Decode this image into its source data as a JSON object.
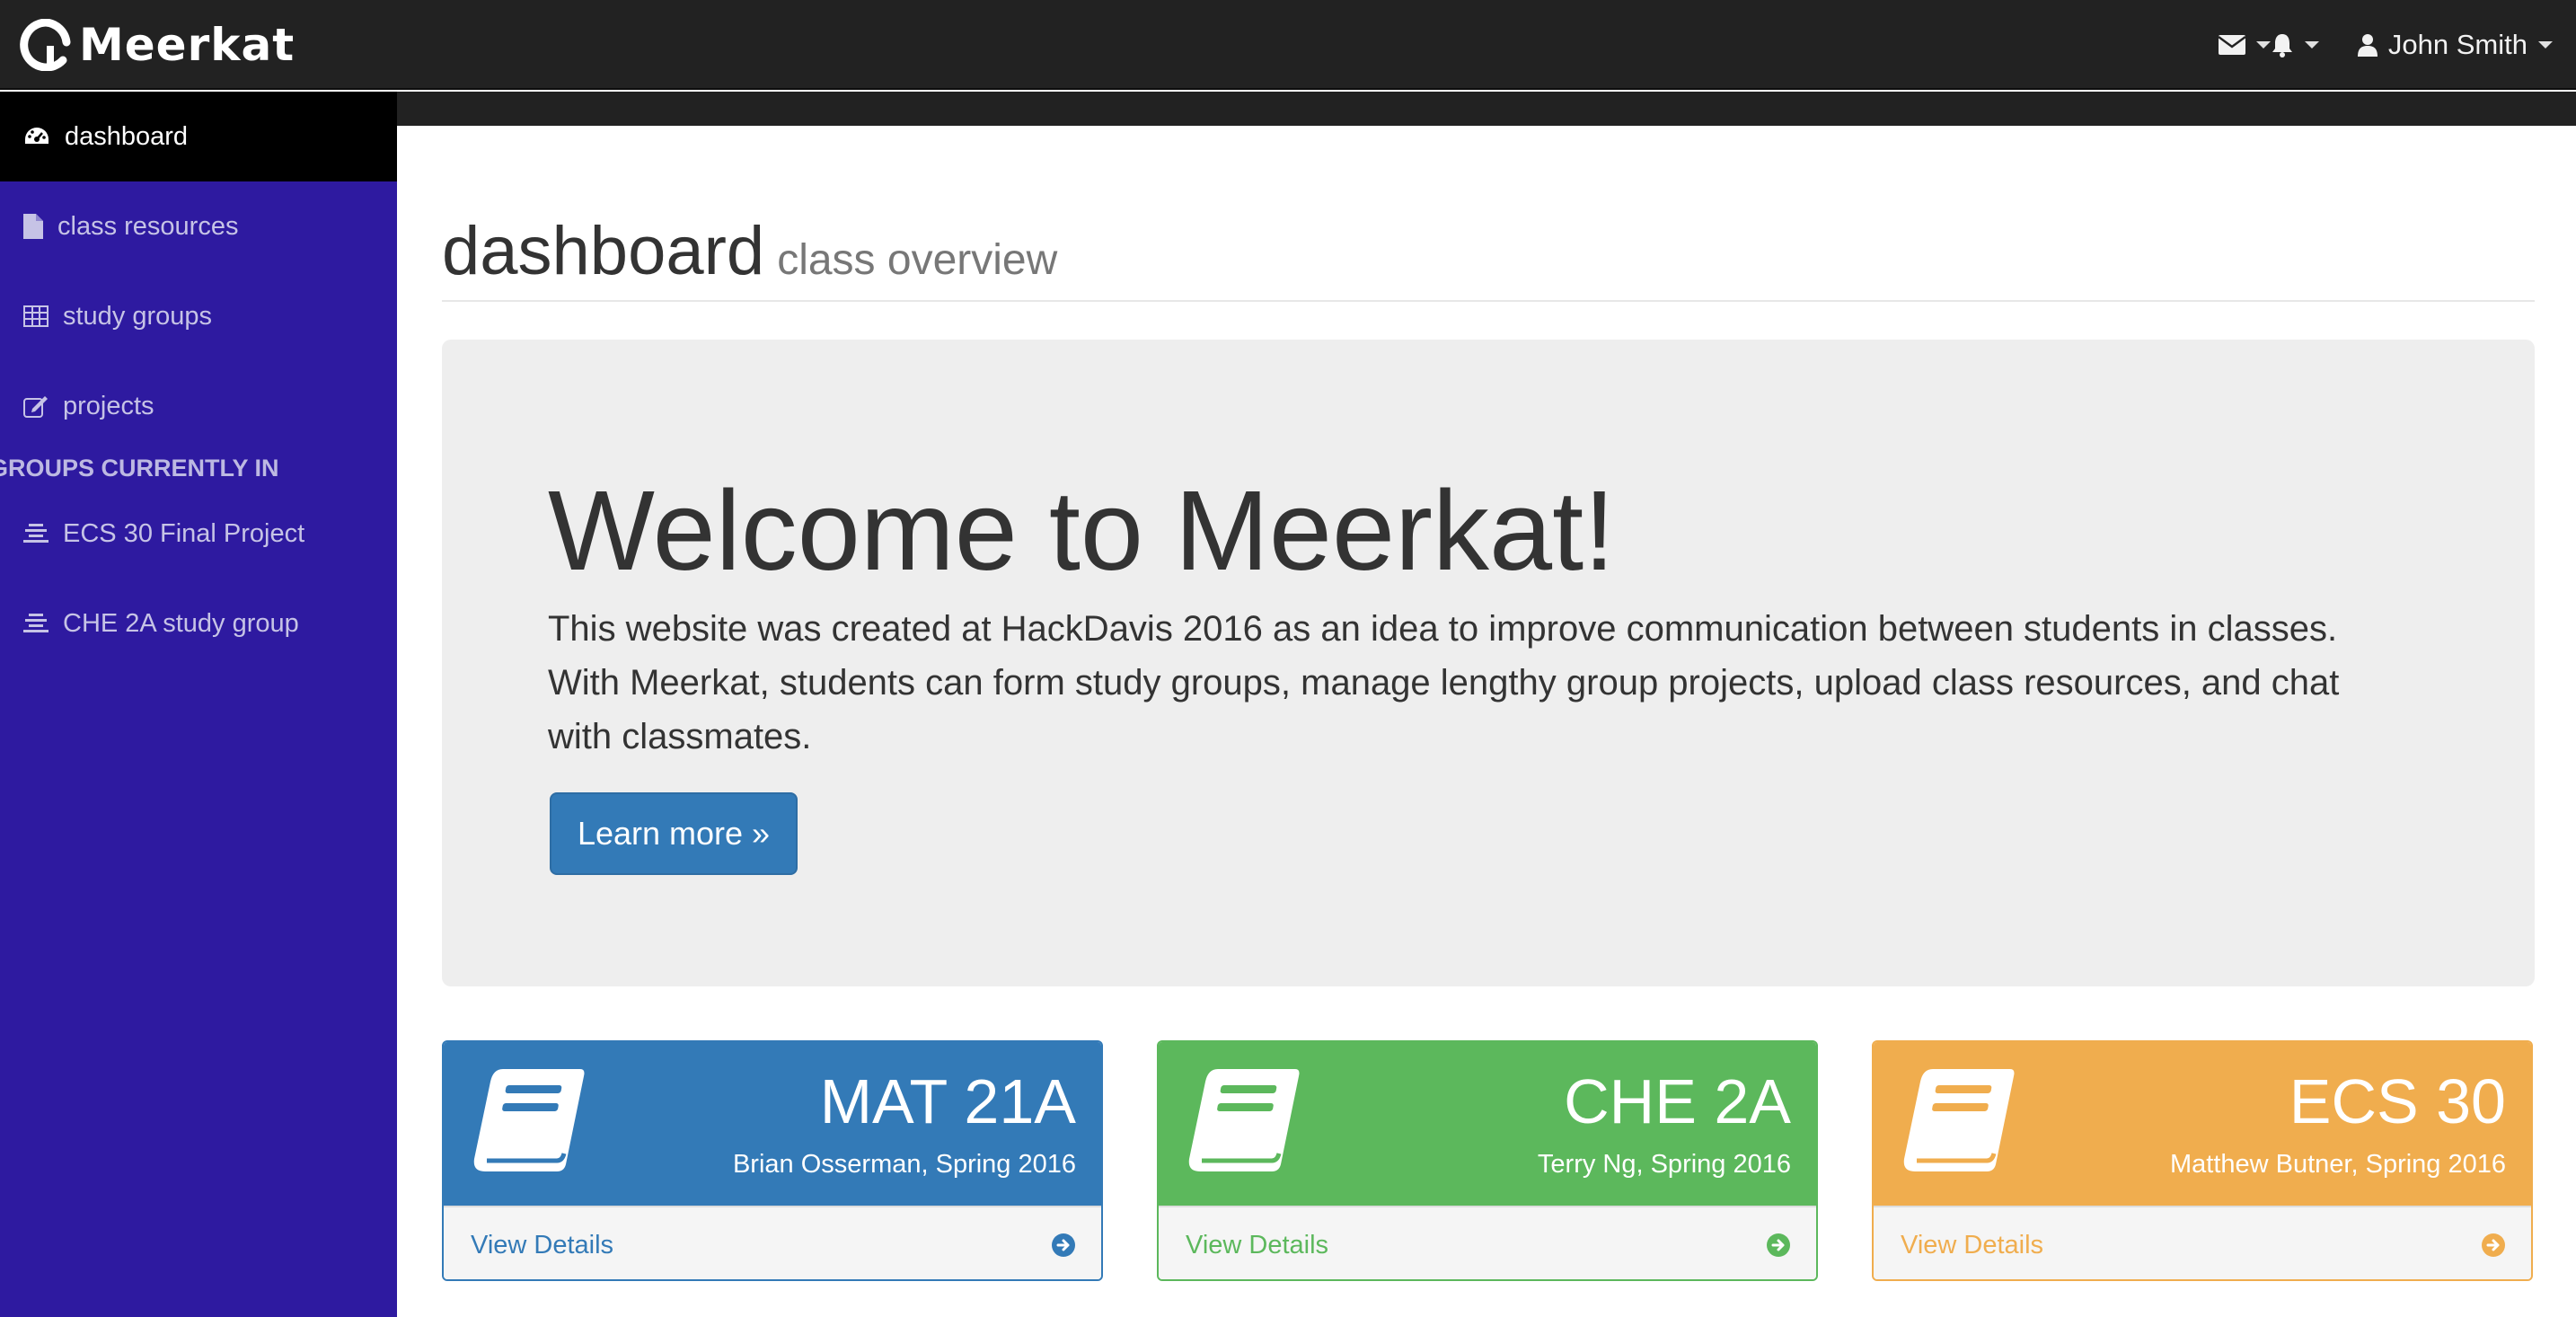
{
  "brand": {
    "name": "Meerkat",
    "logo_icon": "meerkat-logo-icon"
  },
  "navbar": {
    "messages_icon": "envelope-icon",
    "alerts_icon": "bell-icon",
    "user_icon": "user-icon",
    "user_name": "John Smith"
  },
  "sidebar": {
    "items": [
      {
        "label": "dashboard",
        "icon": "dashboard-icon",
        "active": true
      },
      {
        "label": "class resources",
        "icon": "file-icon",
        "active": false
      },
      {
        "label": "study groups",
        "icon": "table-icon",
        "active": false
      },
      {
        "label": "projects",
        "icon": "edit-icon",
        "active": false
      }
    ],
    "groups_header": "GROUPS CURRENTLY IN",
    "groups": [
      {
        "label": "ECS 30 Final Project",
        "icon": "align-center-icon"
      },
      {
        "label": "CHE 2A study group",
        "icon": "align-center-icon"
      }
    ]
  },
  "header": {
    "title": "dashboard",
    "subtitle": "class overview"
  },
  "jumbotron": {
    "title": "Welcome to Meerkat!",
    "text": "This website was created at HackDavis 2016 as an idea to improve communication between students in classes. With Meerkat, students can form study groups, manage lengthy group projects, upload class resources, and chat with classmates.",
    "button_label": "Learn more »"
  },
  "courses": [
    {
      "code": "MAT 21A",
      "instructor": "Brian Osserman, Spring 2016",
      "link": "View Details",
      "color": "#337ab7",
      "icon": "book-icon"
    },
    {
      "code": "CHE 2A",
      "instructor": "Terry Ng, Spring 2016",
      "link": "View Details",
      "color": "#5cb85c",
      "icon": "book-icon"
    },
    {
      "code": "ECS 30",
      "instructor": "Matthew Butner, Spring 2016",
      "link": "View Details",
      "color": "#f0ad4e",
      "icon": "book-icon"
    }
  ],
  "colors": {
    "navbar": "#222222",
    "sidebar": "#2e1aa0",
    "sidebar_active": "#000000",
    "jumbotron": "#eeeeee",
    "primary": "#337ab7"
  }
}
